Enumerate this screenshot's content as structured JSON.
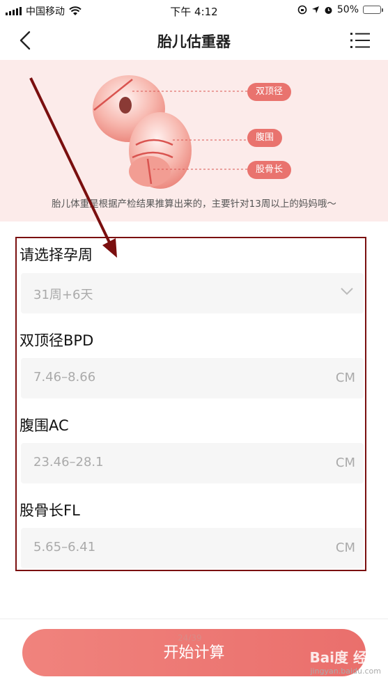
{
  "status_bar": {
    "carrier": "中国移动",
    "time": "下午 4:12",
    "battery": "50%",
    "battery_level": 0.5
  },
  "header": {
    "title": "胎儿估重器"
  },
  "banner": {
    "tags": [
      "双顶径",
      "腹围",
      "股骨长"
    ],
    "description": "胎儿体重是根据产检结果推算出来的，主要针对13周以上的妈妈哦～"
  },
  "form": {
    "week_label": "请选择孕周",
    "week_value": "31周+6天",
    "bpd_label": "双顶径BPD",
    "bpd_placeholder": "7.46–8.66",
    "ac_label": "腹围AC",
    "ac_placeholder": "23.46–28.1",
    "fl_label": "股骨长FL",
    "fl_placeholder": "5.65–6.41",
    "unit": "CM"
  },
  "footer": {
    "calc_button": "开始计算",
    "page_indicator": "24/39"
  },
  "watermark": {
    "brand": "Bai度 经验",
    "url": "jingyan.baidu.com"
  },
  "colors": {
    "accent": "#ea6f6c",
    "banner_bg": "#fcebea",
    "annotation": "#7a0f0f"
  }
}
